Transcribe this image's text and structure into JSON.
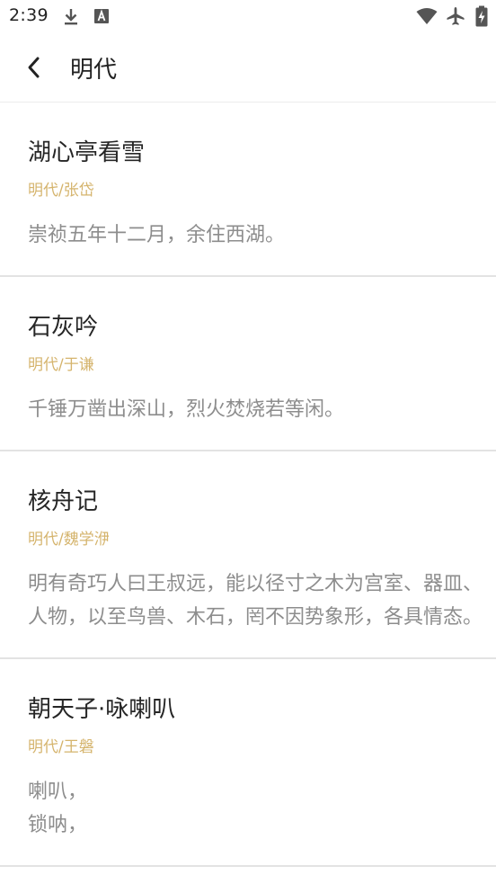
{
  "status_bar": {
    "time": "2:39",
    "icons": [
      "download-icon",
      "font-icon",
      "wifi-icon",
      "airplane-icon",
      "battery-charging-icon"
    ]
  },
  "header": {
    "title": "明代",
    "back_icon": "chevron-left-icon"
  },
  "poems": [
    {
      "title": "湖心亭看雪",
      "author": "明代/张岱",
      "excerpt": "崇祯五年十二月，余住西湖。"
    },
    {
      "title": "石灰吟",
      "author": "明代/于谦",
      "excerpt": "千锤万凿出深山，烈火焚烧若等闲。"
    },
    {
      "title": "核舟记",
      "author": "明代/魏学洢",
      "excerpt": "明有奇巧人曰王叔远，能以径寸之木为宫室、器皿、人物，以至鸟兽、木石，罔不因势象形，各具情态。"
    },
    {
      "title": "朝天子·咏喇叭",
      "author": "明代/王磐",
      "excerpt": "喇叭，\n锁呐，"
    }
  ],
  "colors": {
    "author": "#d5b46d",
    "excerpt": "#8d8d8d",
    "title": "#262626",
    "divider": "#e3e3e3"
  }
}
